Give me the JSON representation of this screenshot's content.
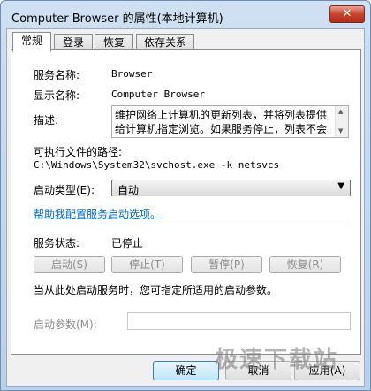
{
  "window": {
    "title": "Computer Browser 的属性(本地计算机)",
    "close_glyph": "✕"
  },
  "tabs": [
    {
      "label": "常规",
      "active": true
    },
    {
      "label": "登录",
      "active": false
    },
    {
      "label": "恢复",
      "active": false
    },
    {
      "label": "依存关系",
      "active": false
    }
  ],
  "general": {
    "service_name_label": "服务名称:",
    "service_name_value": "Browser",
    "display_name_label": "显示名称:",
    "display_name_value": "Computer Browser",
    "description_label": "描述:",
    "description_value": "维护网络上计算机的更新列表，并将列表提供给计算机指定浏览。如果服务停止，列表不会",
    "exe_path_label": "可执行文件的路径:",
    "exe_path_value": "C:\\Windows\\System32\\svchost.exe -k netsvcs",
    "startup_type_label": "启动类型(E):",
    "startup_type_value": "自动",
    "help_link": "帮助我配置服务启动选项。",
    "status_label": "服务状态:",
    "status_value": "已停止",
    "buttons": {
      "start": "启动(S)",
      "stop": "停止(T)",
      "pause": "暂停(P)",
      "resume": "恢复(R)"
    },
    "start_hint": "当从此处启动服务时，您可指定所适用的启动参数。",
    "start_params_label": "启动参数(M):",
    "start_params_value": ""
  },
  "dialog_buttons": {
    "ok": "确定",
    "cancel": "取消",
    "apply": "应用(A)"
  },
  "watermark": "极速下载站"
}
